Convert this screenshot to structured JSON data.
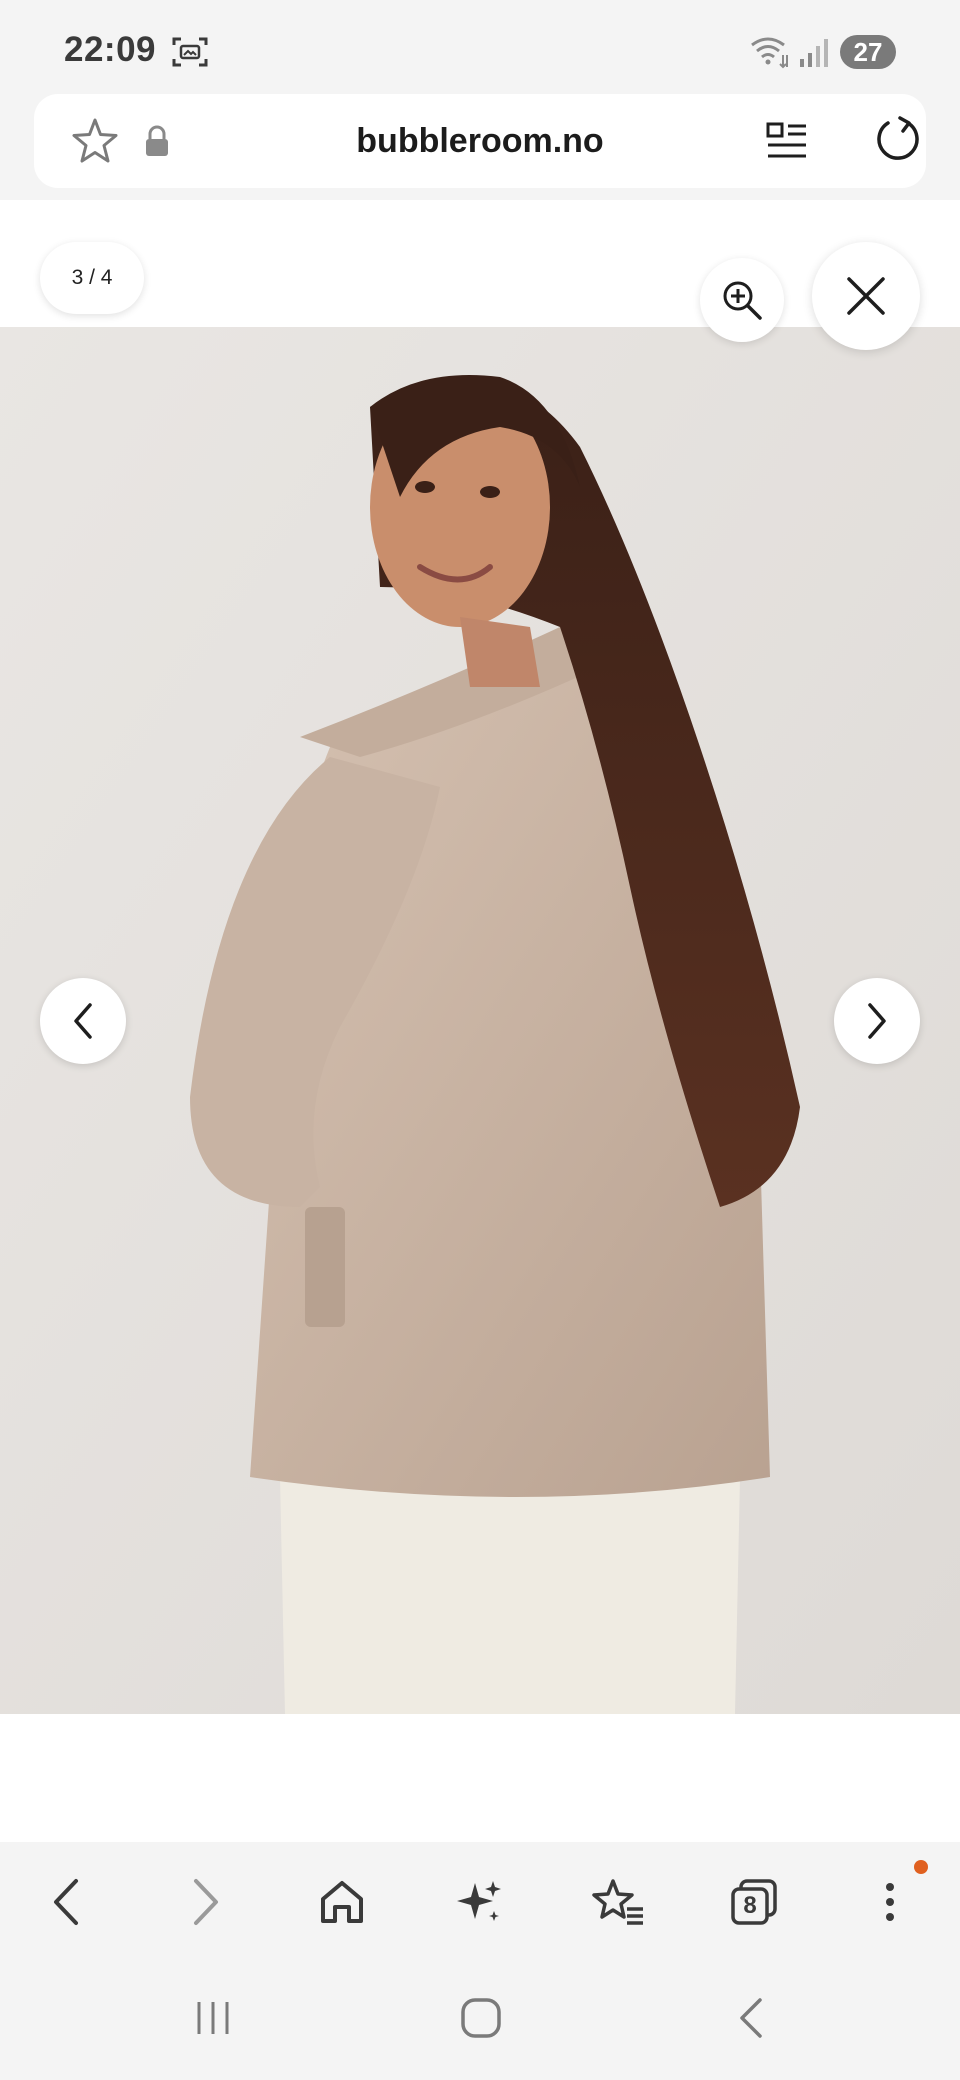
{
  "status_bar": {
    "time": "22:09",
    "battery": "27",
    "icons": [
      "screenshot-icon",
      "wifi-icon",
      "signal-icon",
      "battery-icon"
    ]
  },
  "address_bar": {
    "url": "bubbleroom.no",
    "icons": [
      "star-icon",
      "lock-icon",
      "reader-mode-icon",
      "refresh-icon"
    ]
  },
  "gallery": {
    "counter": "3 / 4",
    "image_alt": "Model in beige wool jacket, photographed from behind looking over shoulder",
    "buttons": [
      "zoom-in-icon",
      "close-icon",
      "chevron-left-icon",
      "chevron-right-icon"
    ]
  },
  "toolbar": {
    "tab_count": "8",
    "icons": [
      "back-icon",
      "forward-icon",
      "home-icon",
      "sparkle-icon",
      "bookmarks-icon",
      "tabs-icon",
      "more-icon"
    ],
    "notification_color": "#e0601f"
  },
  "system_nav": {
    "icons": [
      "recents-icon",
      "home-button-icon",
      "back-button-icon"
    ]
  }
}
